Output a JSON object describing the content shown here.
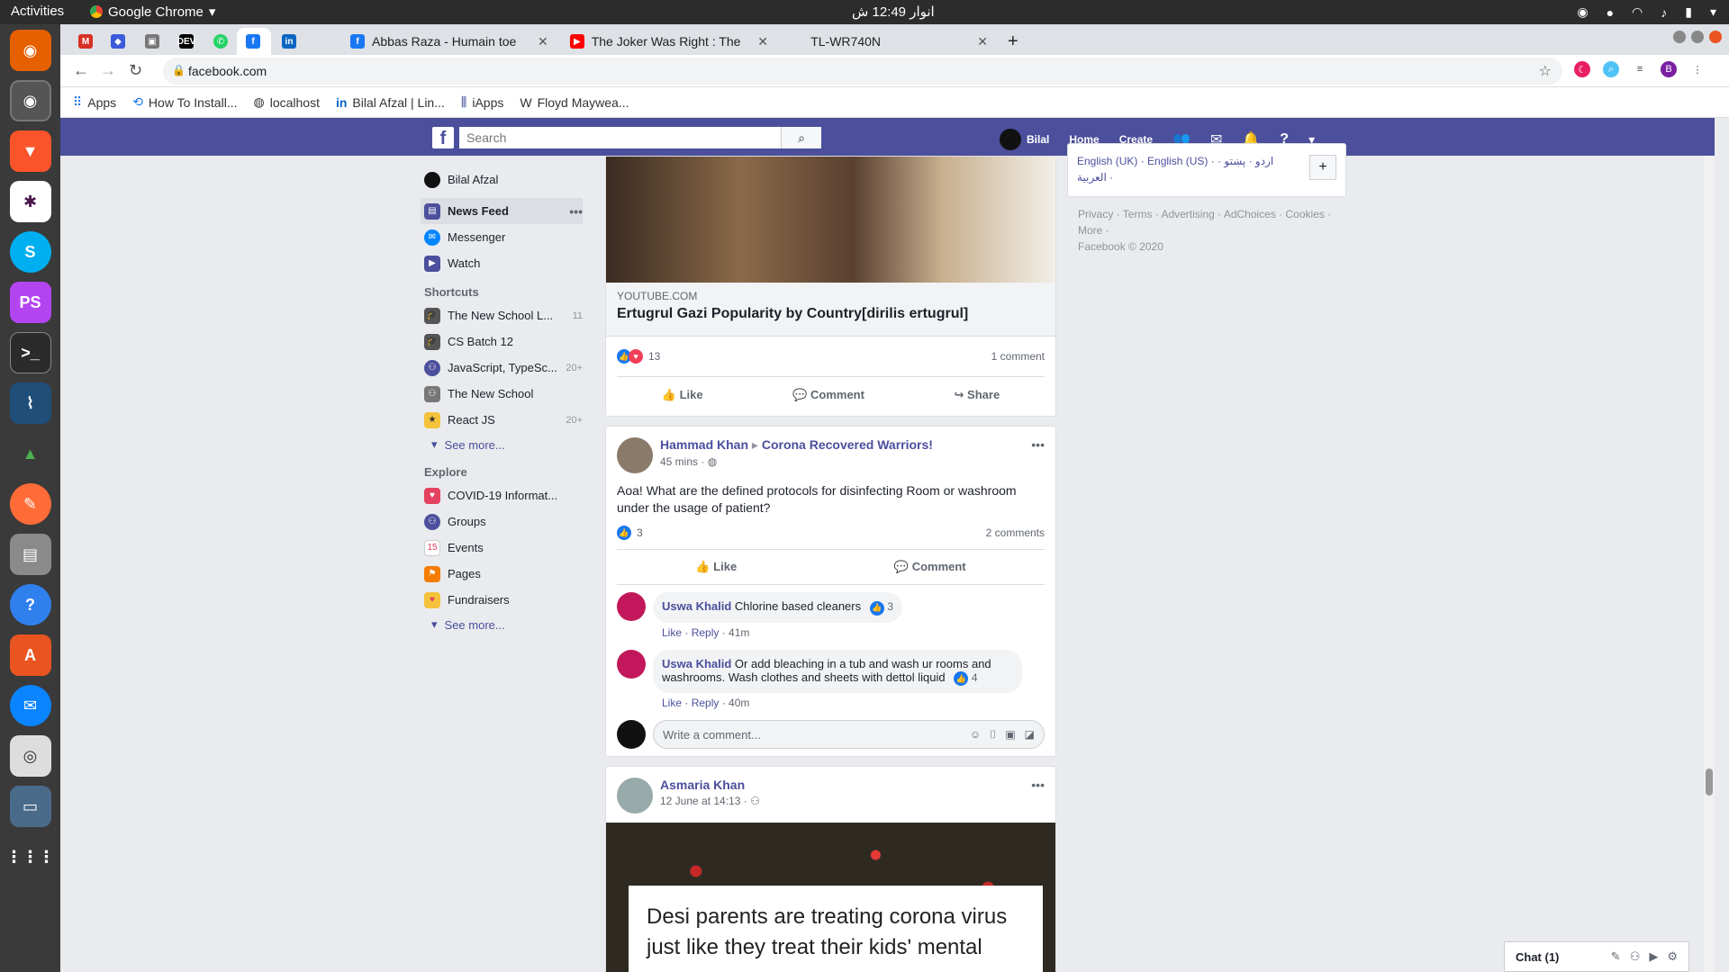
{
  "os": {
    "activities": "Activities",
    "app_name": "Google Chrome",
    "clock": "انوار 12:49 ش"
  },
  "tabs": [
    {
      "title": "Abbas Raza - Humain toe"
    },
    {
      "title": "The Joker Was Right : The"
    },
    {
      "title": "TL-WR740N"
    }
  ],
  "address_bar": {
    "url": "facebook.com"
  },
  "bookmarks": [
    "Apps",
    "How To Install...",
    "localhost",
    "Bilal Afzal | Lin...",
    "iApps",
    "Floyd Maywea..."
  ],
  "fb_header": {
    "search_placeholder": "Search",
    "user_name": "Bilal",
    "home": "Home",
    "create": "Create"
  },
  "left_nav": {
    "profile": "Bilal Afzal",
    "main": [
      {
        "label": "News Feed"
      },
      {
        "label": "Messenger"
      },
      {
        "label": "Watch"
      }
    ],
    "shortcuts_title": "Shortcuts",
    "shortcuts": [
      {
        "label": "The New School L...",
        "count": "11"
      },
      {
        "label": "CS Batch 12",
        "count": ""
      },
      {
        "label": "JavaScript, TypeSc...",
        "count": "20+"
      },
      {
        "label": "The New School",
        "count": ""
      },
      {
        "label": "React JS",
        "count": "20+"
      }
    ],
    "see_more": "See more...",
    "explore_title": "Explore",
    "explore": [
      {
        "label": "COVID-19 Informat..."
      },
      {
        "label": "Groups"
      },
      {
        "label": "Events"
      },
      {
        "label": "Pages"
      },
      {
        "label": "Fundraisers"
      }
    ]
  },
  "post1": {
    "source": "YOUTUBE.COM",
    "title": "Ertugrul Gazi Popularity by Country[dirilis ertugrul]",
    "reactions": "13",
    "comments": "1 comment",
    "like": "Like",
    "comment": "Comment",
    "share": "Share"
  },
  "post2": {
    "author": "Hammad Khan",
    "group": "Corona Recovered Warriors!",
    "time": "45 mins ·",
    "text": "Aoa! What are the defined protocols for disinfecting Room or washroom under the usage of patient?",
    "reactions": "3",
    "comments": "2 comments",
    "like": "Like",
    "comment": "Comment",
    "replies": [
      {
        "author": "Uswa Khalid",
        "text": "Chlorine based cleaners",
        "like": "Like",
        "reply": "Reply",
        "time": "41m",
        "reactions": "3"
      },
      {
        "author": "Uswa Khalid",
        "text": "Or add bleaching in a tub and wash ur rooms and washrooms. Wash clothes and sheets with dettol liquid",
        "like": "Like",
        "reply": "Reply",
        "time": "40m",
        "reactions": "4"
      }
    ],
    "comment_placeholder": "Write a comment..."
  },
  "post3": {
    "author": "Asmaria Khan",
    "time": "12 June at 14:13 ·",
    "image_text": "Desi parents are treating corona virus just like they treat their kids' mental"
  },
  "right": {
    "languages": "English (UK) · English (US) · اردو · پښتو · العربية ·",
    "footer_links": "Privacy · Terms · Advertising · AdChoices · Cookies · More ·",
    "copyright": "Facebook © 2020"
  },
  "chat": {
    "label": "Chat (1)"
  }
}
